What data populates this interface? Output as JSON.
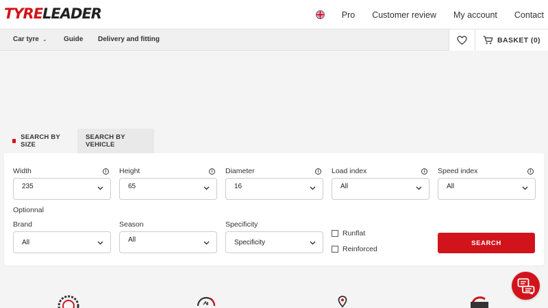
{
  "header": {
    "logo_prefix": "TYRE",
    "logo_suffix": "LEADER",
    "links": [
      "Pro",
      "Customer review",
      "My account",
      "Contact"
    ]
  },
  "nav": {
    "items": [
      "Car tyre",
      "Guide",
      "Delivery and fitting"
    ],
    "basket_label": "BASKET",
    "basket_count": "(0)"
  },
  "tabs": [
    "SEARCH BY SIZE",
    "SEARCH BY VEHICLE"
  ],
  "form": {
    "width": {
      "label": "Width",
      "value": "235"
    },
    "height": {
      "label": "Height",
      "value": "65"
    },
    "diameter": {
      "label": "Diameter",
      "value": "16"
    },
    "load_index": {
      "label": "Load index",
      "value": "All"
    },
    "speed_index": {
      "label": "Speed index",
      "value": "All"
    },
    "optional_label": "Optionnal",
    "brand": {
      "label": "Brand",
      "value": "All"
    },
    "season": {
      "label": "Season",
      "value": "All"
    },
    "specificity": {
      "label": "Specificity",
      "value": "Specificity"
    },
    "runflat_label": "Runflat",
    "reinforced_label": "Reinforced",
    "search_label": "SEARCH",
    "info_glyph": "i"
  },
  "colors": {
    "accent": "#d1141b"
  },
  "icons": [
    "uk-flag-icon",
    "chevron-down-icon",
    "heart-icon",
    "cart-icon",
    "info-icon",
    "tyre-icon",
    "clock-24-icon",
    "location-pin-icon",
    "wallet-icon",
    "chat-icon"
  ]
}
